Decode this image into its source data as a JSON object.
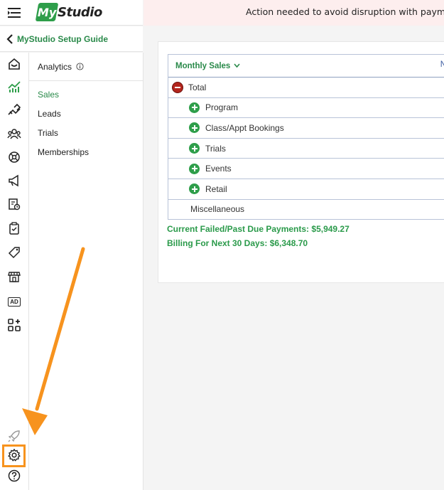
{
  "header": {
    "logo_prefix": "My",
    "logo_word": "Studio",
    "banner_text": "Action needed to avoid disruption with payments a"
  },
  "setup_guide": {
    "label": "MyStudio Setup Guide"
  },
  "rail": {
    "icons": [
      "home-icon",
      "analytics-icon",
      "handshake-icon",
      "members-icon",
      "programs-icon",
      "megaphone-icon",
      "schedule-icon",
      "checklist-icon",
      "tag-icon",
      "store-icon",
      "ad-icon",
      "apps-icon",
      "rocket-icon",
      "settings-icon",
      "help-icon"
    ],
    "ad_label": "AD"
  },
  "submenu": {
    "title": "Analytics",
    "items": [
      {
        "label": "Sales",
        "active": true
      },
      {
        "label": "Leads",
        "active": false
      },
      {
        "label": "Trials",
        "active": false
      },
      {
        "label": "Memberships",
        "active": false
      }
    ]
  },
  "report": {
    "dropdown_label": "Monthly Sales",
    "right_header_fragment": "N",
    "rows": [
      {
        "label": "Total",
        "kind": "collapse"
      },
      {
        "label": "Program",
        "kind": "expand"
      },
      {
        "label": "Class/Appt Bookings",
        "kind": "expand"
      },
      {
        "label": "Trials",
        "kind": "expand"
      },
      {
        "label": "Events",
        "kind": "expand"
      },
      {
        "label": "Retail",
        "kind": "expand"
      },
      {
        "label": "Miscellaneous",
        "kind": "none"
      }
    ],
    "failed_payments": "Current Failed/Past Due Payments: $5,949.27",
    "billing_next": "Billing For Next 30 Days: $6,348.70"
  },
  "colors": {
    "brand_green": "#2e9e4a",
    "banner_bg": "#fdeeee",
    "highlight_orange": "#f7931e",
    "collapse_red": "#b3261e"
  }
}
